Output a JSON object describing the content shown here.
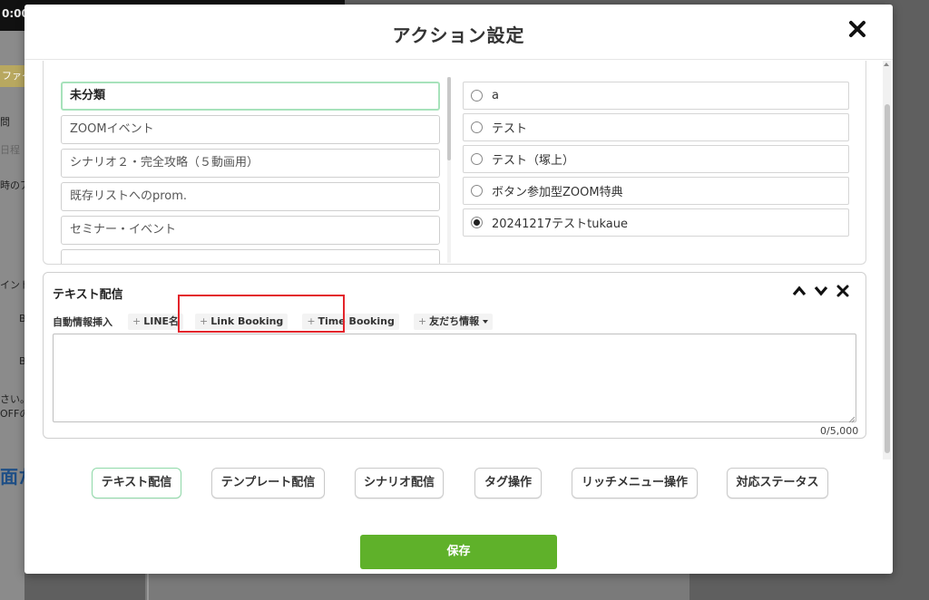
{
  "background": {
    "time": "0:00",
    "fragments": [
      "ファイ",
      "問",
      "日程",
      "時のア",
      "イント",
      "B",
      "B",
      "さい。",
      "OFFの",
      "面た"
    ]
  },
  "modal": {
    "title": "アクション設定",
    "close_icon": "close-icon"
  },
  "categories": {
    "items": [
      {
        "label": "未分類",
        "selected": true
      },
      {
        "label": "ZOOMイベント",
        "selected": false
      },
      {
        "label": "シナリオ２・完全攻略（５動画用）",
        "selected": false
      },
      {
        "label": "既存リストへのprom.",
        "selected": false
      },
      {
        "label": "セミナー・イベント",
        "selected": false
      },
      {
        "label": "",
        "selected": false
      }
    ]
  },
  "options": {
    "items": [
      {
        "label": "a",
        "checked": false
      },
      {
        "label": "テスト",
        "checked": false
      },
      {
        "label": "テスト（塚上）",
        "checked": false
      },
      {
        "label": "ボタン参加型ZOOM特典",
        "checked": false
      },
      {
        "label": "20241217テストtukaue",
        "checked": true
      }
    ]
  },
  "text_panel": {
    "title": "テキスト配信",
    "insert_label": "自動情報挿入",
    "chips": [
      {
        "plus": "+",
        "label": "LINE名"
      },
      {
        "plus": "+",
        "label": "Link Booking"
      },
      {
        "plus": "+",
        "label": "Time Booking"
      },
      {
        "plus": "+",
        "label": "友だち情報"
      }
    ],
    "message_value": "",
    "counter": "0/5,000",
    "controls": [
      "chevron-up-icon",
      "chevron-down-icon",
      "close-icon"
    ]
  },
  "actions": {
    "buttons": [
      {
        "label": "テキスト配信",
        "active": true
      },
      {
        "label": "テンプレート配信",
        "active": false
      },
      {
        "label": "シナリオ配信",
        "active": false
      },
      {
        "label": "タグ操作",
        "active": false
      },
      {
        "label": "リッチメニュー操作",
        "active": false
      },
      {
        "label": "対応ステータス",
        "active": false
      }
    ]
  },
  "save_label": "保存",
  "colors": {
    "accent_green": "#5fb12a",
    "selected_border": "#a7e2bb",
    "highlight_red": "#e3242b"
  }
}
